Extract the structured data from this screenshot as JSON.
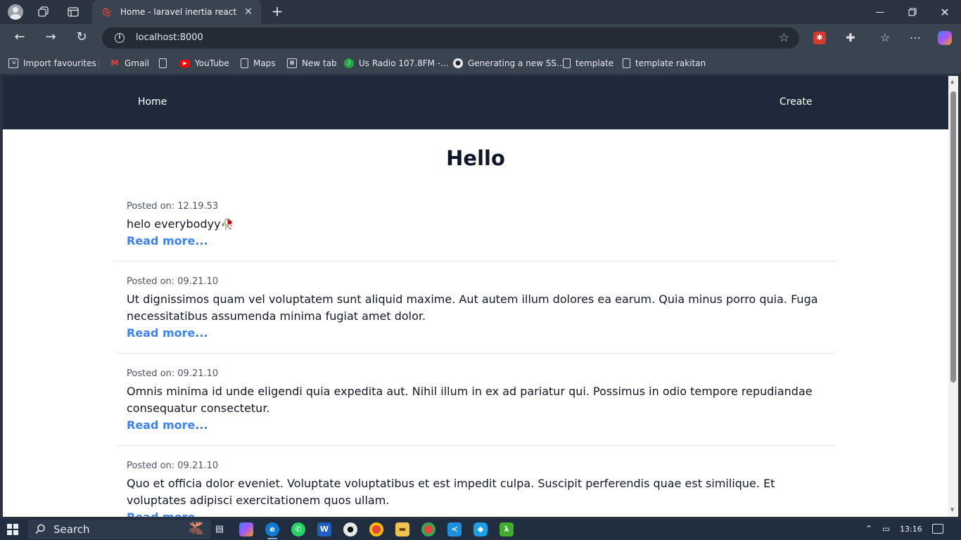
{
  "browser": {
    "tab": {
      "title": "Home - laravel inertia react"
    },
    "address": {
      "url": "localhost:8000"
    },
    "bookmarks": [
      {
        "label": "Import favourites",
        "icon": "import-icon"
      },
      {
        "label": "Gmail",
        "icon": "gmail-icon"
      },
      {
        "label": "",
        "icon": "page-icon"
      },
      {
        "label": "YouTube",
        "icon": "youtube-icon"
      },
      {
        "label": "Maps",
        "icon": "page-icon"
      },
      {
        "label": "New tab",
        "icon": "newtab-icon"
      },
      {
        "label": "Us Radio 107.8FM -...",
        "icon": "radio-icon"
      },
      {
        "label": "Generating a new SS...",
        "icon": "github-icon"
      },
      {
        "label": "template",
        "icon": "page-icon"
      },
      {
        "label": "template rakitan",
        "icon": "page-icon"
      }
    ]
  },
  "site": {
    "nav": {
      "home": "Home",
      "create": "Create"
    },
    "title": "Hello",
    "posts": [
      {
        "date": "Posted on: 12.19.53",
        "body": "helo everybodyy",
        "emoji": "🥀",
        "link": "Read more..."
      },
      {
        "date": "Posted on: 09.21.10",
        "body": "Ut dignissimos quam vel voluptatem sunt aliquid maxime. Aut autem illum dolores ea earum. Quia minus porro quia. Fuga necessitatibus assumenda minima fugiat amet dolor.",
        "link": "Read more..."
      },
      {
        "date": "Posted on: 09.21.10",
        "body": "Omnis minima id unde eligendi quia expedita aut. Nihil illum in ex ad pariatur qui. Possimus in odio tempore repudiandae consequatur consectetur.",
        "link": "Read more..."
      },
      {
        "date": "Posted on: 09.21.10",
        "body": "Quo et officia dolor eveniet. Voluptate voluptatibus et est impedit culpa. Suscipit perferendis quae est similique. Et voluptates adipisci exercitationem quos ullam.",
        "link": "Read more..."
      }
    ]
  },
  "taskbar": {
    "search_label": "Search",
    "clock": "13:16"
  },
  "colors": {
    "nav_bg": "#1e293b",
    "link": "#3b82f6",
    "title": "#0f172a"
  }
}
